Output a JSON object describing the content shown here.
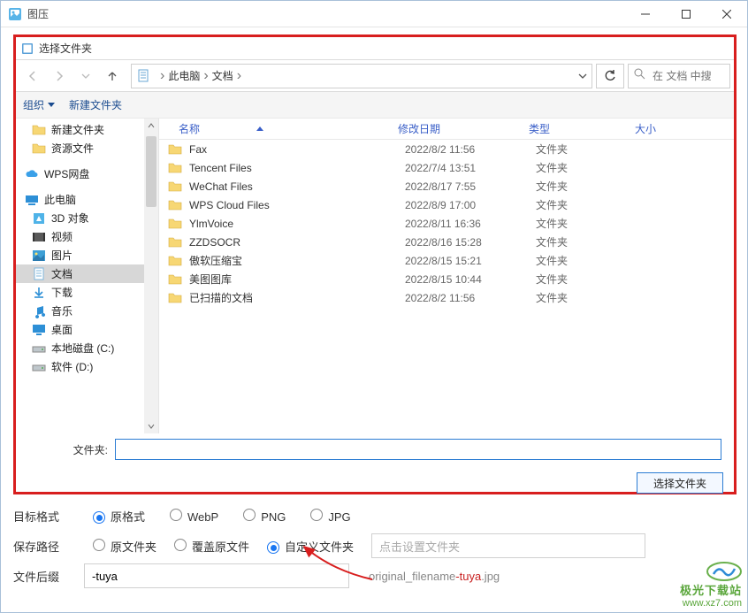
{
  "app": {
    "title": "图压"
  },
  "dialog": {
    "title": "选择文件夹",
    "breadcrumb": {
      "root": "此电脑",
      "current": "文档"
    },
    "searchPlaceholder": "在 文档 中搜",
    "toolbar": {
      "organize": "组织",
      "newFolder": "新建文件夹"
    },
    "columns": {
      "name": "名称",
      "date": "修改日期",
      "type": "类型",
      "size": "大小"
    },
    "tree": {
      "top": [
        {
          "label": "新建文件夹",
          "icon": "folder"
        },
        {
          "label": "资源文件",
          "icon": "folder"
        }
      ],
      "wps": "WPS网盘",
      "thisPc": "此电脑",
      "pcItems": [
        {
          "label": "3D 对象",
          "icon": "3d"
        },
        {
          "label": "视频",
          "icon": "video"
        },
        {
          "label": "图片",
          "icon": "pictures"
        },
        {
          "label": "文档",
          "icon": "documents",
          "selected": true
        },
        {
          "label": "下载",
          "icon": "downloads"
        },
        {
          "label": "音乐",
          "icon": "music"
        },
        {
          "label": "桌面",
          "icon": "desktop"
        },
        {
          "label": "本地磁盘 (C:)",
          "icon": "drive"
        },
        {
          "label": "软件 (D:)",
          "icon": "drive"
        }
      ]
    },
    "files": [
      {
        "name": "Fax",
        "date": "2022/8/2 11:56",
        "type": "文件夹"
      },
      {
        "name": "Tencent Files",
        "date": "2022/7/4 13:51",
        "type": "文件夹"
      },
      {
        "name": "WeChat Files",
        "date": "2022/8/17 7:55",
        "type": "文件夹"
      },
      {
        "name": "WPS Cloud Files",
        "date": "2022/8/9 17:00",
        "type": "文件夹"
      },
      {
        "name": "YlmVoice",
        "date": "2022/8/11 16:36",
        "type": "文件夹"
      },
      {
        "name": "ZZDSOCR",
        "date": "2022/8/16 15:28",
        "type": "文件夹"
      },
      {
        "name": "傲软压缩宝",
        "date": "2022/8/15 15:21",
        "type": "文件夹"
      },
      {
        "name": "美图图库",
        "date": "2022/8/15 10:44",
        "type": "文件夹"
      },
      {
        "name": "已扫描的文档",
        "date": "2022/8/2 11:56",
        "type": "文件夹"
      }
    ],
    "folderLabel": "文件夹:",
    "folderValue": "",
    "selectBtn": "选择文件夹"
  },
  "options": {
    "formatLabel": "目标格式",
    "formats": [
      {
        "label": "原格式",
        "checked": true
      },
      {
        "label": "WebP",
        "checked": false
      },
      {
        "label": "PNG",
        "checked": false
      },
      {
        "label": "JPG",
        "checked": false
      }
    ],
    "savePathLabel": "保存路径",
    "saveOptions": [
      {
        "label": "原文件夹",
        "checked": false
      },
      {
        "label": "覆盖原文件",
        "checked": false
      },
      {
        "label": "自定义文件夹",
        "checked": true
      }
    ],
    "pathPlaceholder": "点击设置文件夹",
    "suffixLabel": "文件后缀",
    "suffixValue": "-tuya",
    "previewPrefix": "original_filename",
    "previewSuffix": "-tuya",
    "previewExt": ".jpg"
  },
  "watermark": {
    "line1": "极光下载站",
    "line2": "www.xz7.com"
  }
}
